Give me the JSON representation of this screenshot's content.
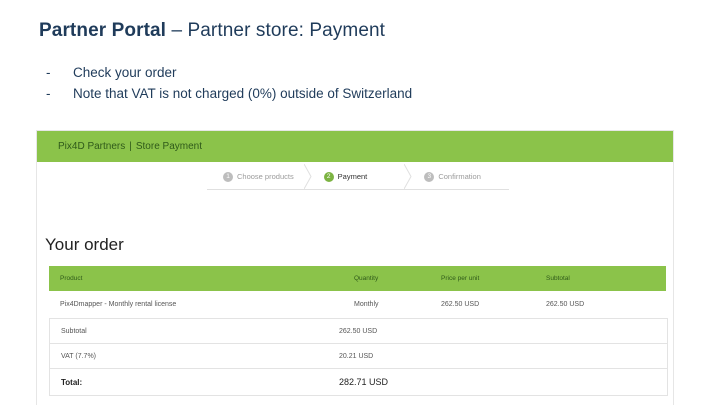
{
  "slide": {
    "title_bold": "Partner Portal",
    "title_rest": " – Partner store: Payment",
    "bullets": [
      {
        "marker": "-",
        "text": "Check your order"
      },
      {
        "marker": "-",
        "text": "Note that VAT is not charged (0%) outside of Switzerland"
      }
    ]
  },
  "app": {
    "brand": "Pix4D Partners",
    "separator": "|",
    "page": "Store Payment",
    "accent_color": "#8bc34a",
    "steps": [
      {
        "num": "1",
        "label": "Choose products",
        "active": false
      },
      {
        "num": "2",
        "label": "Payment",
        "active": true
      },
      {
        "num": "3",
        "label": "Confirmation",
        "active": false
      }
    ],
    "order_title": "Your order",
    "table": {
      "headers": [
        "Product",
        "Quantity",
        "Price per unit",
        "Subtotal"
      ],
      "rows": [
        [
          "Pix4Dmapper - Monthly rental license",
          "Monthly",
          "262.50 USD",
          "262.50 USD"
        ]
      ]
    },
    "totals": {
      "subtotal_label": "Subtotal",
      "subtotal_value": "262.50 USD",
      "vat_label": "VAT (7.7%)",
      "vat_value": "20.21 USD",
      "total_label": "Total:",
      "total_value": "282.71 USD"
    }
  }
}
